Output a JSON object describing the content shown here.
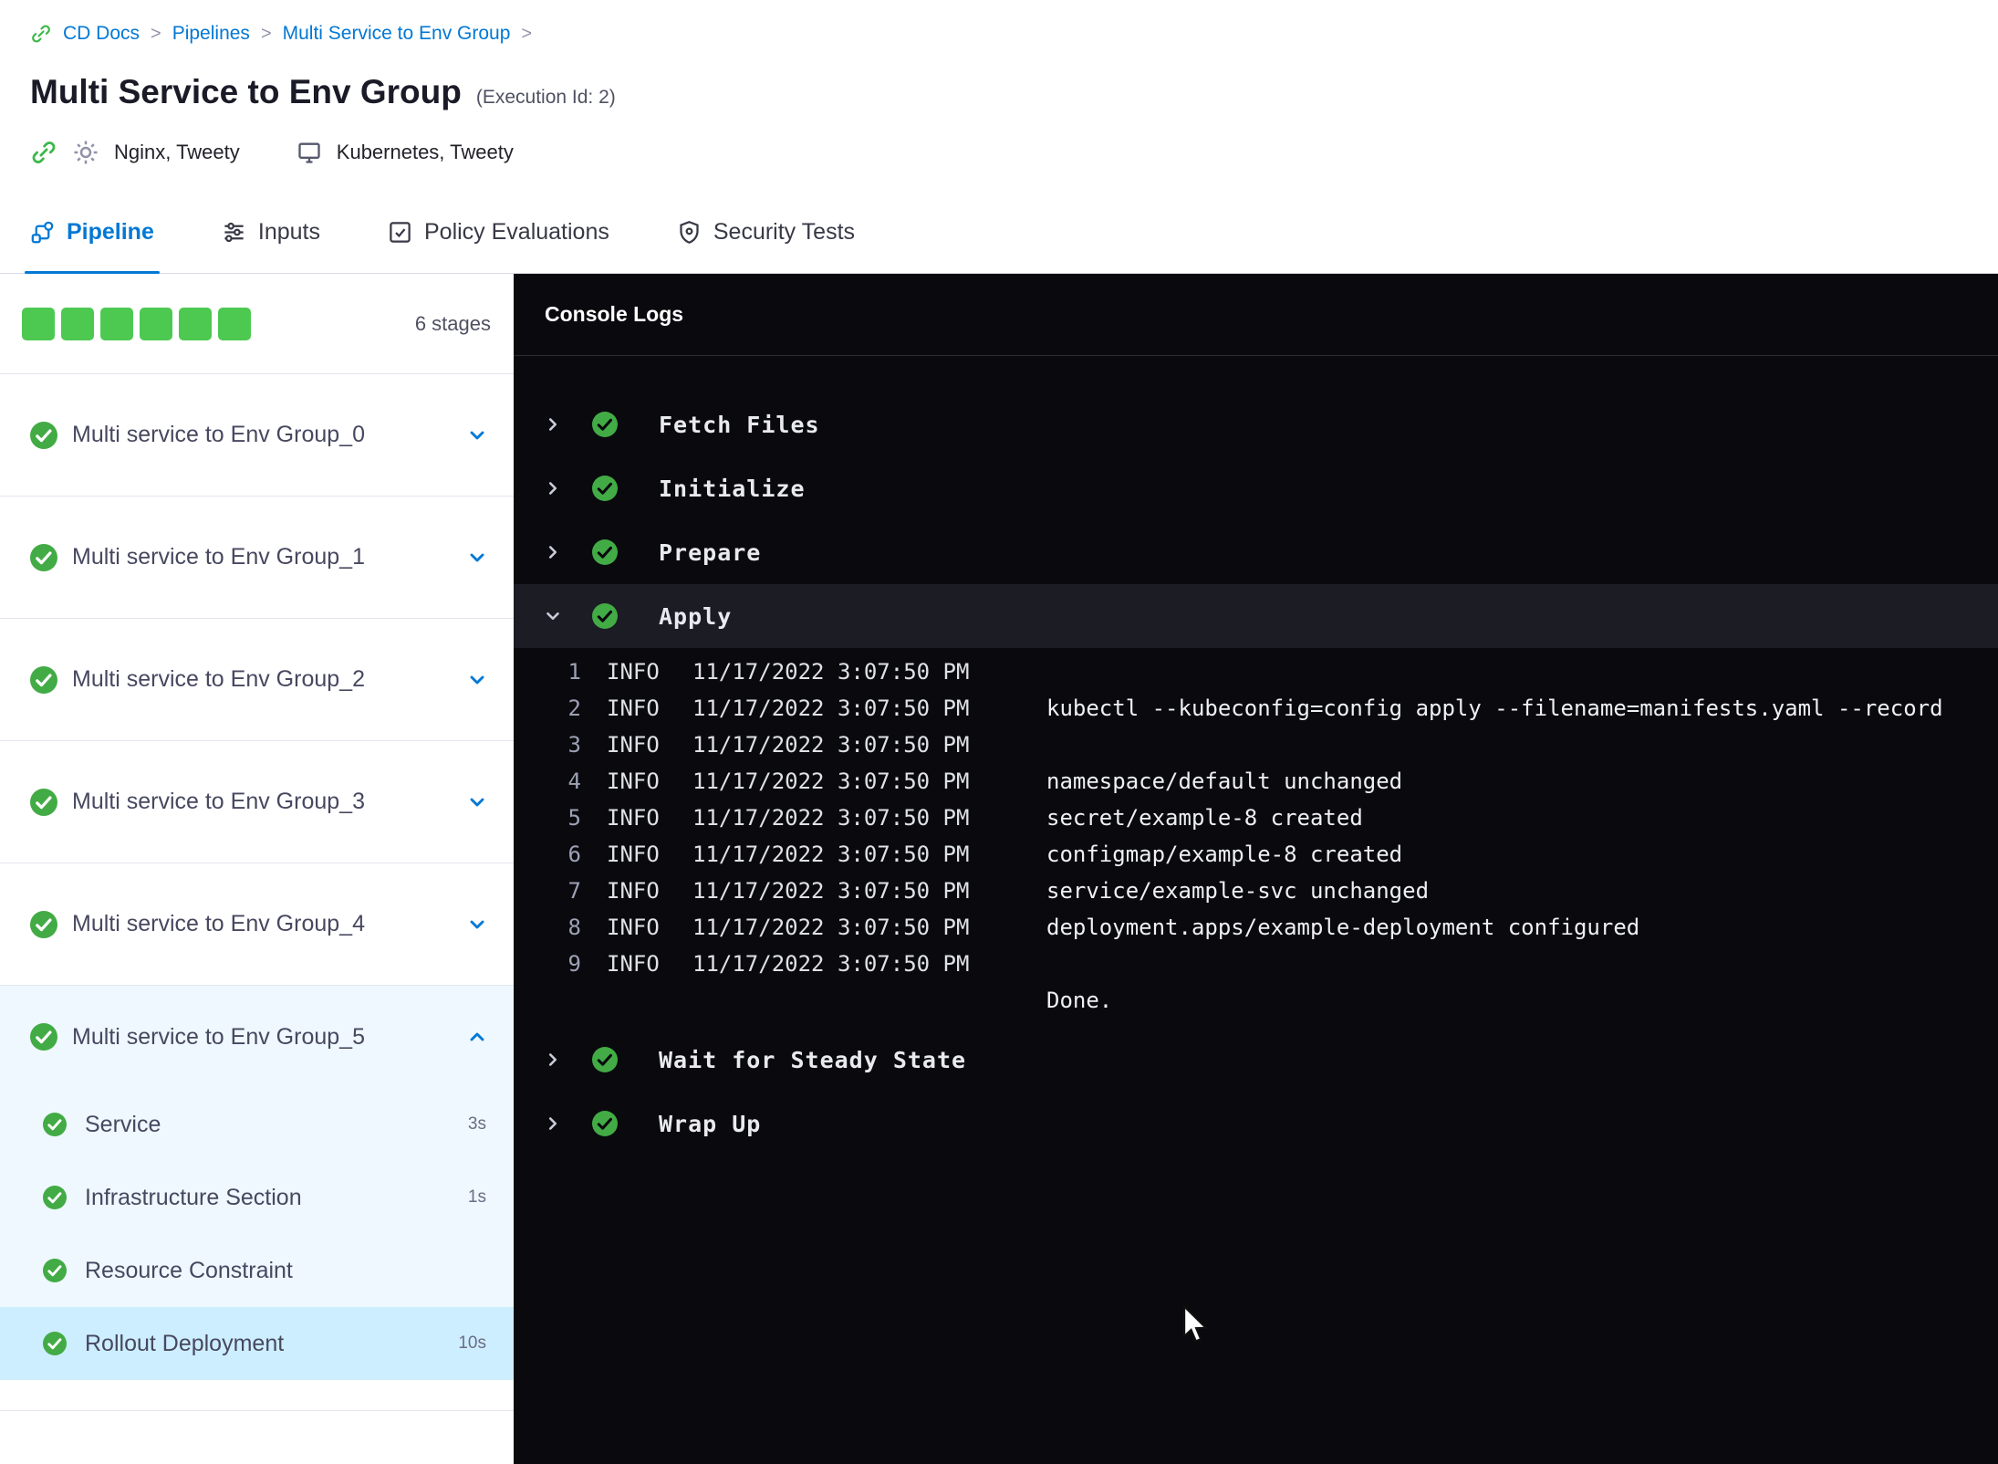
{
  "colors": {
    "accent": "#0278d5",
    "success": "#42ab45",
    "progress_square": "#4dc952",
    "console_bg": "#0a0a0e",
    "expanded_bg": "#eef8fe",
    "selected_bg": "#cdeefe"
  },
  "breadcrumb": {
    "separator": ">",
    "items": [
      {
        "label": "CD Docs"
      },
      {
        "label": "Pipelines"
      },
      {
        "label": "Multi Service to Env Group"
      }
    ]
  },
  "header": {
    "title": "Multi Service to Env Group",
    "execution_id": "(Execution Id: 2)",
    "services": "Nginx, Tweety",
    "environments": "Kubernetes, Tweety"
  },
  "tabs": [
    {
      "label": "Pipeline",
      "active": true
    },
    {
      "label": "Inputs",
      "active": false
    },
    {
      "label": "Policy Evaluations",
      "active": false
    },
    {
      "label": "Security Tests",
      "active": false
    }
  ],
  "sidebar": {
    "stages_count_label": "6 stages",
    "stages": [
      {
        "label": "Multi service to Env Group_0",
        "status": "success",
        "expanded": false
      },
      {
        "label": "Multi service to Env Group_1",
        "status": "success",
        "expanded": false
      },
      {
        "label": "Multi service to Env Group_2",
        "status": "success",
        "expanded": false
      },
      {
        "label": "Multi service to Env Group_3",
        "status": "success",
        "expanded": false
      },
      {
        "label": "Multi service to Env Group_4",
        "status": "success",
        "expanded": false
      },
      {
        "label": "Multi service to Env Group_5",
        "status": "success",
        "expanded": true,
        "steps": [
          {
            "label": "Service",
            "duration": "3s",
            "status": "success",
            "selected": false
          },
          {
            "label": "Infrastructure Section",
            "duration": "1s",
            "status": "success",
            "selected": false
          },
          {
            "label": "Resource Constraint",
            "duration": "",
            "status": "success",
            "selected": false
          },
          {
            "label": "Rollout Deployment",
            "duration": "10s",
            "status": "success",
            "selected": true
          }
        ]
      }
    ]
  },
  "console": {
    "title": "Console Logs",
    "steps": [
      {
        "label": "Fetch Files",
        "status": "success",
        "expanded": false
      },
      {
        "label": "Initialize",
        "status": "success",
        "expanded": false
      },
      {
        "label": "Prepare",
        "status": "success",
        "expanded": false
      },
      {
        "label": "Apply",
        "status": "success",
        "expanded": true,
        "logs": [
          {
            "num": "1",
            "level": "INFO",
            "time": "11/17/2022 3:07:50 PM",
            "msg": ""
          },
          {
            "num": "2",
            "level": "INFO",
            "time": "11/17/2022 3:07:50 PM",
            "msg": "kubectl --kubeconfig=config apply --filename=manifests.yaml --record"
          },
          {
            "num": "3",
            "level": "INFO",
            "time": "11/17/2022 3:07:50 PM",
            "msg": ""
          },
          {
            "num": "4",
            "level": "INFO",
            "time": "11/17/2022 3:07:50 PM",
            "msg": "namespace/default unchanged"
          },
          {
            "num": "5",
            "level": "INFO",
            "time": "11/17/2022 3:07:50 PM",
            "msg": "secret/example-8 created"
          },
          {
            "num": "6",
            "level": "INFO",
            "time": "11/17/2022 3:07:50 PM",
            "msg": "configmap/example-8 created"
          },
          {
            "num": "7",
            "level": "INFO",
            "time": "11/17/2022 3:07:50 PM",
            "msg": "service/example-svc unchanged"
          },
          {
            "num": "8",
            "level": "INFO",
            "time": "11/17/2022 3:07:50 PM",
            "msg": "deployment.apps/example-deployment configured"
          },
          {
            "num": "9",
            "level": "INFO",
            "time": "11/17/2022 3:07:50 PM",
            "msg": ""
          }
        ],
        "tail": "Done."
      },
      {
        "label": "Wait for Steady State",
        "status": "success",
        "expanded": false
      },
      {
        "label": "Wrap Up",
        "status": "success",
        "expanded": false
      }
    ]
  }
}
